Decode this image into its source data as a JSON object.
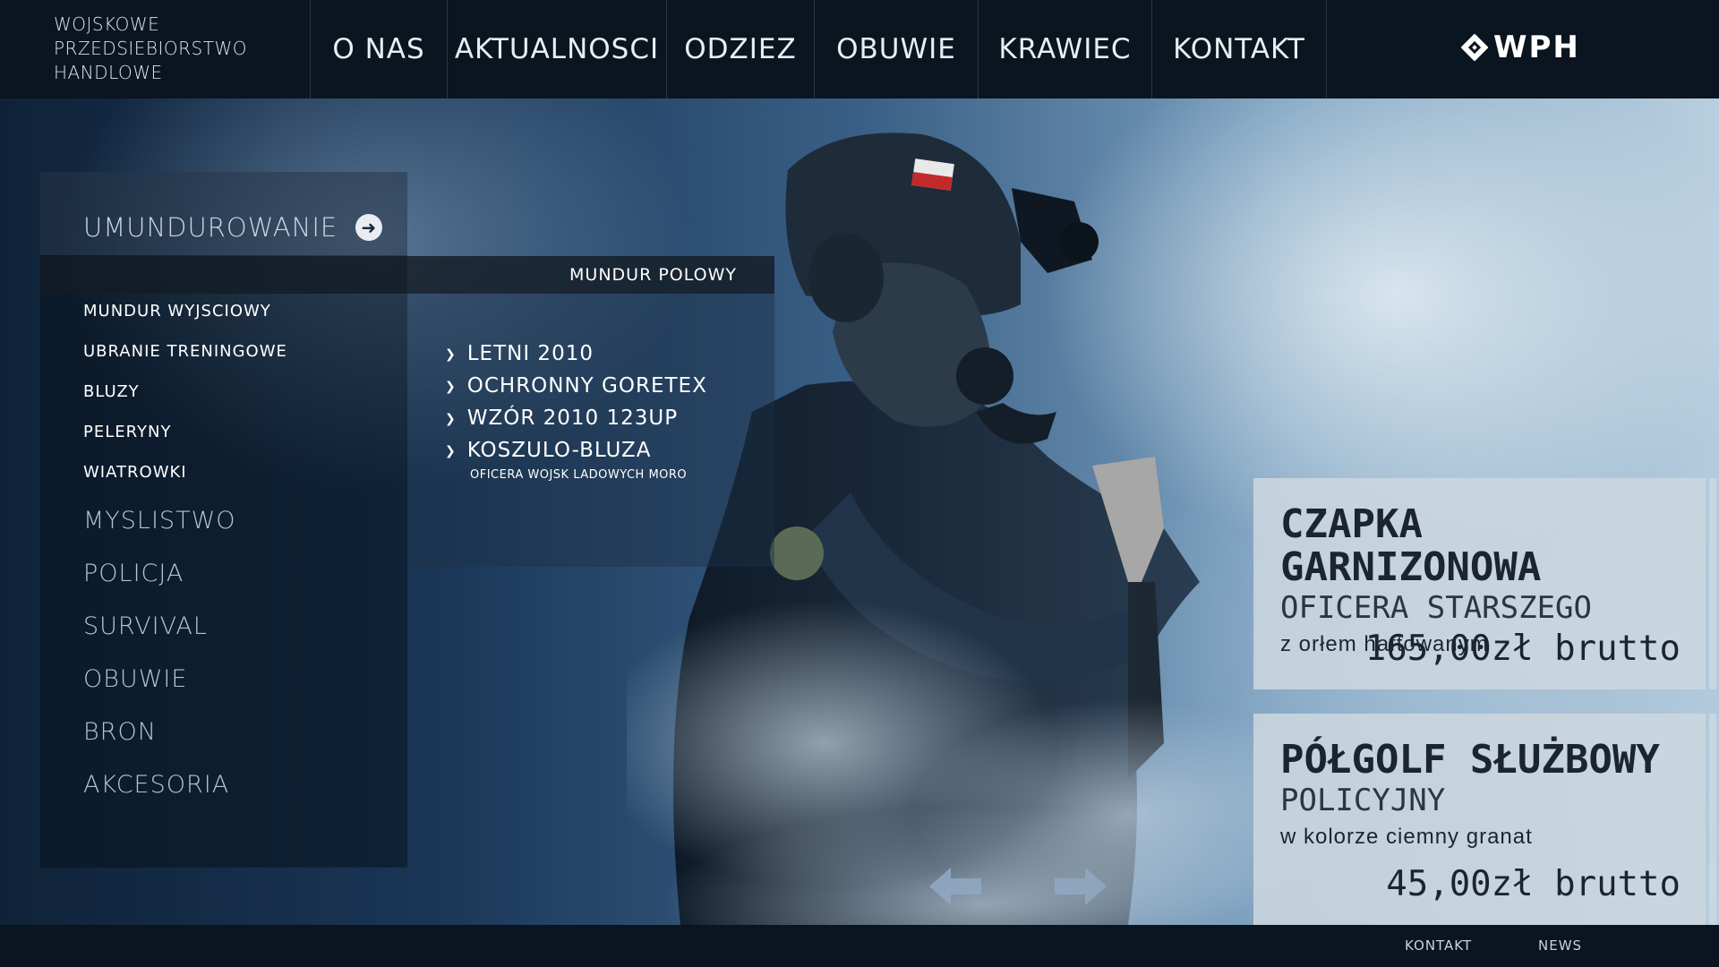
{
  "brand": {
    "lines": [
      "WOJSKOWE",
      "PRZEDSIEBIORSTWO",
      "HANDLOWE"
    ]
  },
  "nav": {
    "items": [
      {
        "label": "O NAS"
      },
      {
        "label": "AKTUALNOSCI"
      },
      {
        "label": "ODZIEZ"
      },
      {
        "label": "OBUWIE"
      },
      {
        "label": "KRAWIEC"
      },
      {
        "label": "KONTAKT"
      }
    ]
  },
  "logo": {
    "text": "WPH",
    "icon": "wph-emblem-icon"
  },
  "sidebar": {
    "category": "UMUNDUROWANIE",
    "active_item": "MUNDUR POLOWY",
    "sub_items": [
      "MUNDUR WYJSCIOWY",
      "UBRANIE TRENINGOWE",
      "BLUZY",
      "PELERYNY",
      "WIATROWKI"
    ],
    "main_items": [
      "MYSLISTWO",
      "POLICJA",
      "SURVIVAL",
      "OBUWIE",
      "BRON",
      "AKCESORIA"
    ]
  },
  "dropdown": {
    "products": [
      "LETNI 2010",
      "OCHRONNY GORETEX",
      "WZÓR 2010 123UP",
      "KOSZULO-BLUZA"
    ],
    "note": "OFICERA WOJSK LADOWYCH MORO"
  },
  "cards": [
    {
      "title": "CZAPKA GARNIZONOWA",
      "subtitle": "OFICERA STARSZEGO",
      "desc": "z orłem haftowanym",
      "price": "165,00zł brutto"
    },
    {
      "title": "PÓŁGOLF SŁUŻBOWY",
      "subtitle": "POLICYJNY",
      "desc": "w kolorze ciemny granat",
      "price": "45,00zł brutto"
    }
  ],
  "footer": {
    "links": [
      "KONTAKT",
      "NEWS"
    ]
  },
  "colors": {
    "topbar": "#0a1520",
    "accent": "#e7edf2",
    "card_bg": "#cdd7e0"
  }
}
